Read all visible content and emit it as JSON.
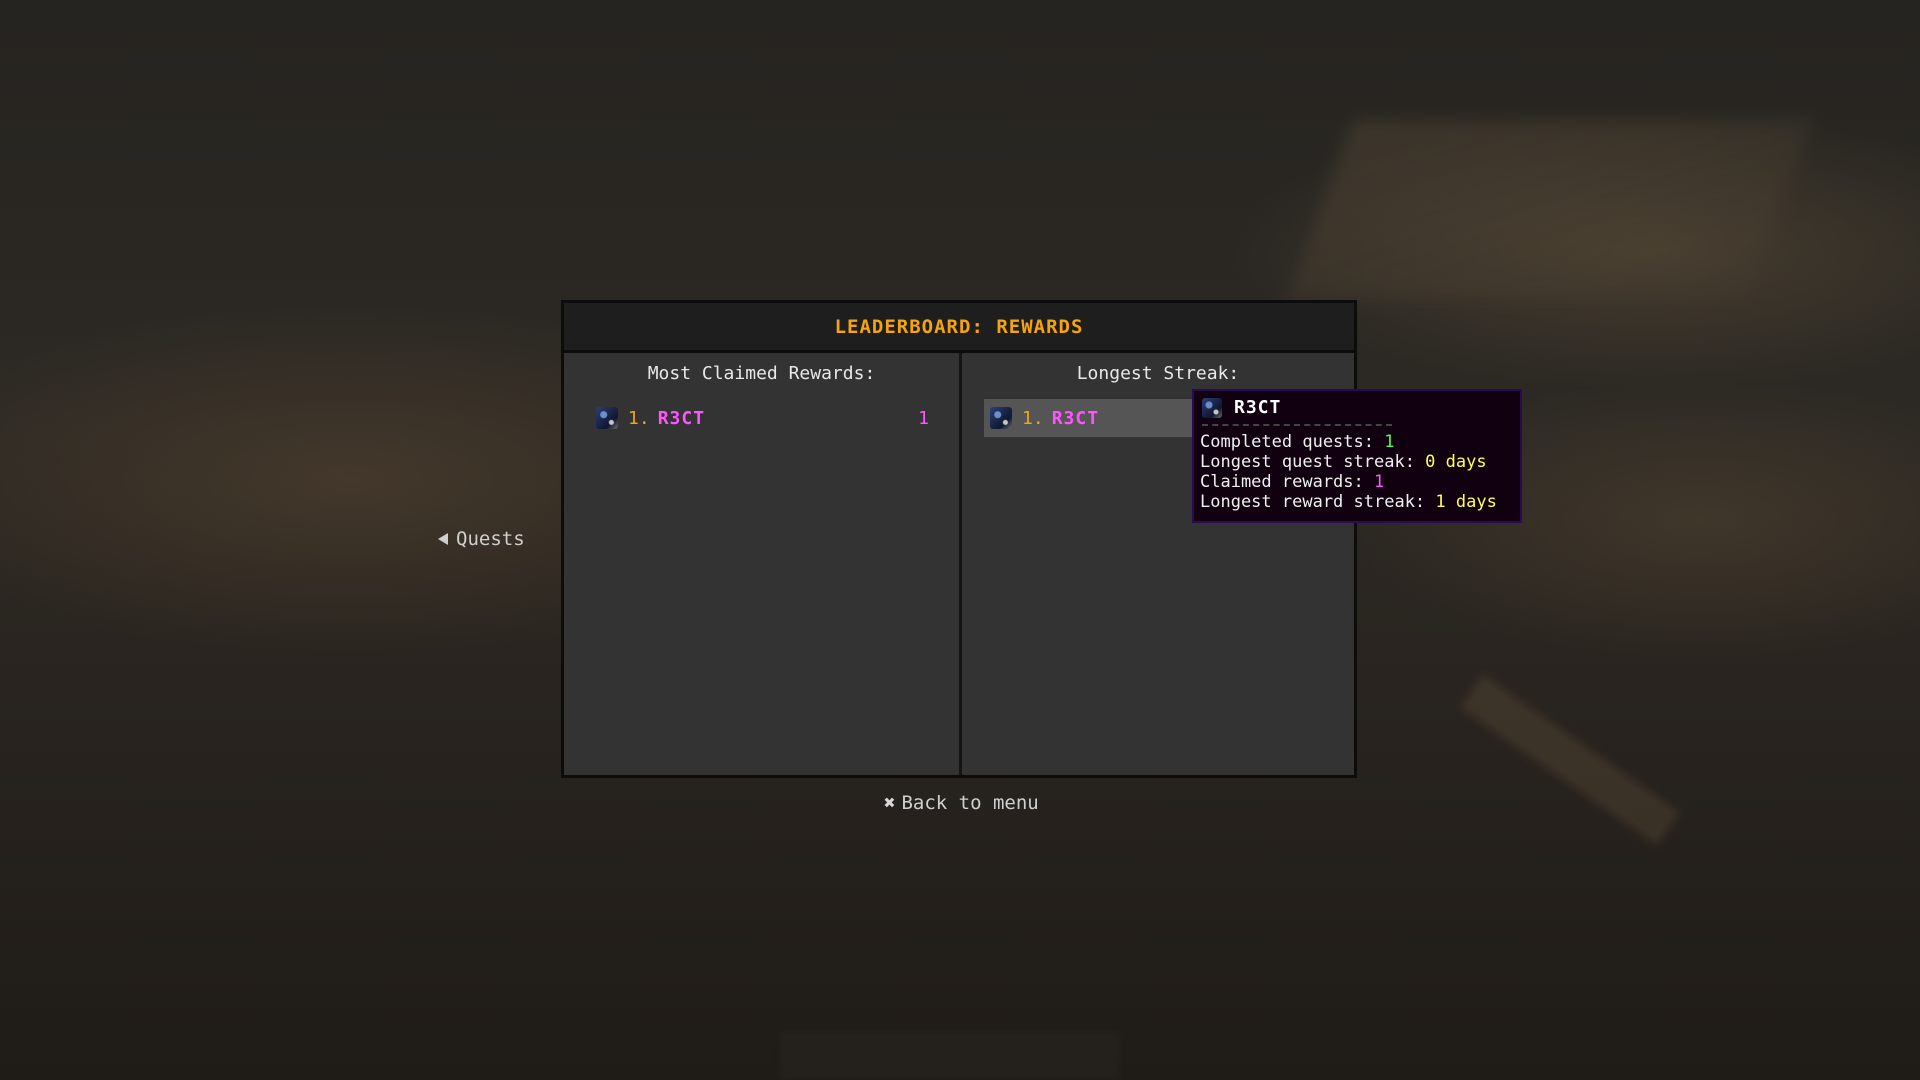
{
  "side_nav": {
    "label": "Quests",
    "icon": "triangle-left-icon"
  },
  "panel": {
    "title": "LEADERBOARD: REWARDS",
    "left_column": {
      "heading": "Most Claimed Rewards:",
      "entries": [
        {
          "rank": "1.",
          "name": "R3CT",
          "value": "1"
        }
      ]
    },
    "right_column": {
      "heading": "Longest Streak:",
      "entries": [
        {
          "rank": "1.",
          "name": "R3CT"
        }
      ]
    }
  },
  "back": {
    "icon": "close-x-icon",
    "glyph": "✖",
    "label": "Back to menu"
  },
  "tooltip": {
    "player": "R3CT",
    "lines": [
      {
        "label": "Completed quests: ",
        "value": "1",
        "color": "#55ff55"
      },
      {
        "label": "Longest quest streak: ",
        "value": "0 days",
        "color": "#ffff55"
      },
      {
        "label": "Claimed rewards: ",
        "value": "1",
        "color": "#ff55ff"
      },
      {
        "label": "Longest reward streak: ",
        "value": "1 days",
        "color": "#ffff55"
      }
    ]
  },
  "colors": {
    "title": "#f5a30f",
    "rank": "#f2a31a",
    "player_name": "#ff55ff"
  }
}
